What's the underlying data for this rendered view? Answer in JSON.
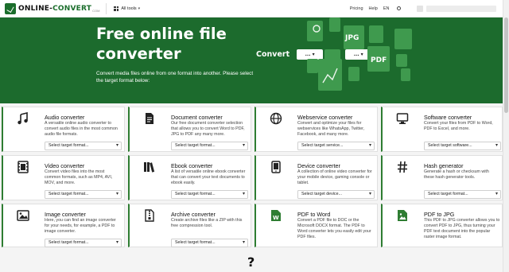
{
  "header": {
    "logo_main": "ONLINE-",
    "logo_accent": "CONVERT",
    "logo_sub": "COM",
    "all_tools": "All tools",
    "pricing": "Pricing",
    "help": "Help",
    "language": "EN"
  },
  "hero": {
    "title": "Free online file converter",
    "subtitle": "Convert media files online from one format into another. Please select the target format below:",
    "convert_label": "Convert",
    "from_value": "...",
    "to_label": "to",
    "to_value": "...",
    "art_labels": [
      "JPG",
      "PDF"
    ]
  },
  "colors": {
    "brand_green": "#1c6b2d",
    "card_accent": "#2e7d32"
  },
  "cards": [
    {
      "icon": "music-note-icon",
      "title": "Audio converter",
      "desc": "A versatile online audio converter to convert audio files in the most common audio file formats.",
      "select": "Select target format..."
    },
    {
      "icon": "document-icon",
      "title": "Document converter",
      "desc": "Our free document converter selection that allows you to convert Word to PDF, JPG to PDF any many more.",
      "select": "Select target format..."
    },
    {
      "icon": "globe-icon",
      "title": "Webservice converter",
      "desc": "Convert and optimize your files for webservices like WhatsApp, Twitter, Facebook, and many more.",
      "select": "Select target service..."
    },
    {
      "icon": "monitor-icon",
      "title": "Software converter",
      "desc": "Convert your files from PDF to Word, PDF to Excel, and more.",
      "select": "Select target software..."
    },
    {
      "icon": "video-icon",
      "title": "Video converter",
      "desc": "Convert video files into the most common formats, such as MP4, AVI, MOV, and more.",
      "select": "Select target format..."
    },
    {
      "icon": "books-icon",
      "title": "Ebook converter",
      "desc": "A list of versatile online ebook converter that can convert your text documents to ebook easily.",
      "select": "Select target format..."
    },
    {
      "icon": "tablet-icon",
      "title": "Device converter",
      "desc": "A collection of online video converter for your mobile device, gaming console or tablet.",
      "select": "Select target device..."
    },
    {
      "icon": "hash-icon",
      "title": "Hash generator",
      "desc": "Generate a hash or checksum with these hash generator tools.",
      "select": "Select target format..."
    },
    {
      "icon": "image-icon",
      "title": "Image converter",
      "desc": "Here, you can find an image converter for your needs, for example, a PDF to image converter.",
      "select": "Select target format..."
    },
    {
      "icon": "archive-icon",
      "title": "Archive converter",
      "desc": "Create archive files like a ZIP with this free compression tool.",
      "select": "Select target format..."
    },
    {
      "icon": "word-file-icon",
      "title": "PDF to Word",
      "desc": "Convert a PDF file to DOC or the Microsoft DOCX format. The PDF to Word converter lets you easily edit your PDF files.",
      "select": ""
    },
    {
      "icon": "jpg-file-icon",
      "title": "PDF to JPG",
      "desc": "This PDF to JPG converter allows you to convert PDF to JPG, thus turning your PDF text document into the popular raster image format.",
      "select": ""
    }
  ],
  "footer": {
    "question_mark": "?"
  }
}
